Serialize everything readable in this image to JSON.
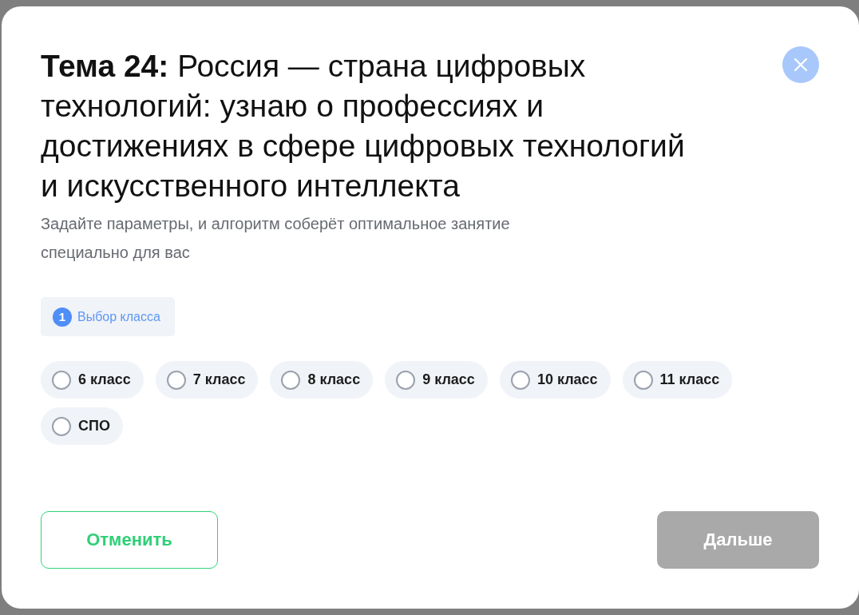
{
  "dialog": {
    "title": "**Тема 24:** Россия — страна цифровых технологий: узнаю о профессиях и достижениях в сфере цифровых технологий и искусственного интеллекта",
    "subtitle": "Задайте параметры, и алгоритм соберёт оптимальное занятие специально для вас",
    "steps": [
      {
        "number": "1",
        "label": "Выбор класса",
        "selected": true
      }
    ],
    "options": [
      {
        "label": "6 класс",
        "selected": false
      },
      {
        "label": "7 класс",
        "selected": false
      },
      {
        "label": "8 класс",
        "selected": false
      },
      {
        "label": "9 класс",
        "selected": false
      },
      {
        "label": "10 класс",
        "selected": false
      },
      {
        "label": "11 класс",
        "selected": false
      },
      {
        "label": "СПО",
        "selected": false
      }
    ],
    "buttons": [
      {
        "label": "Отменить",
        "kind": "secondary",
        "disabled": false
      },
      {
        "label": "Дальше",
        "kind": "primary",
        "disabled": true
      }
    ]
  }
}
